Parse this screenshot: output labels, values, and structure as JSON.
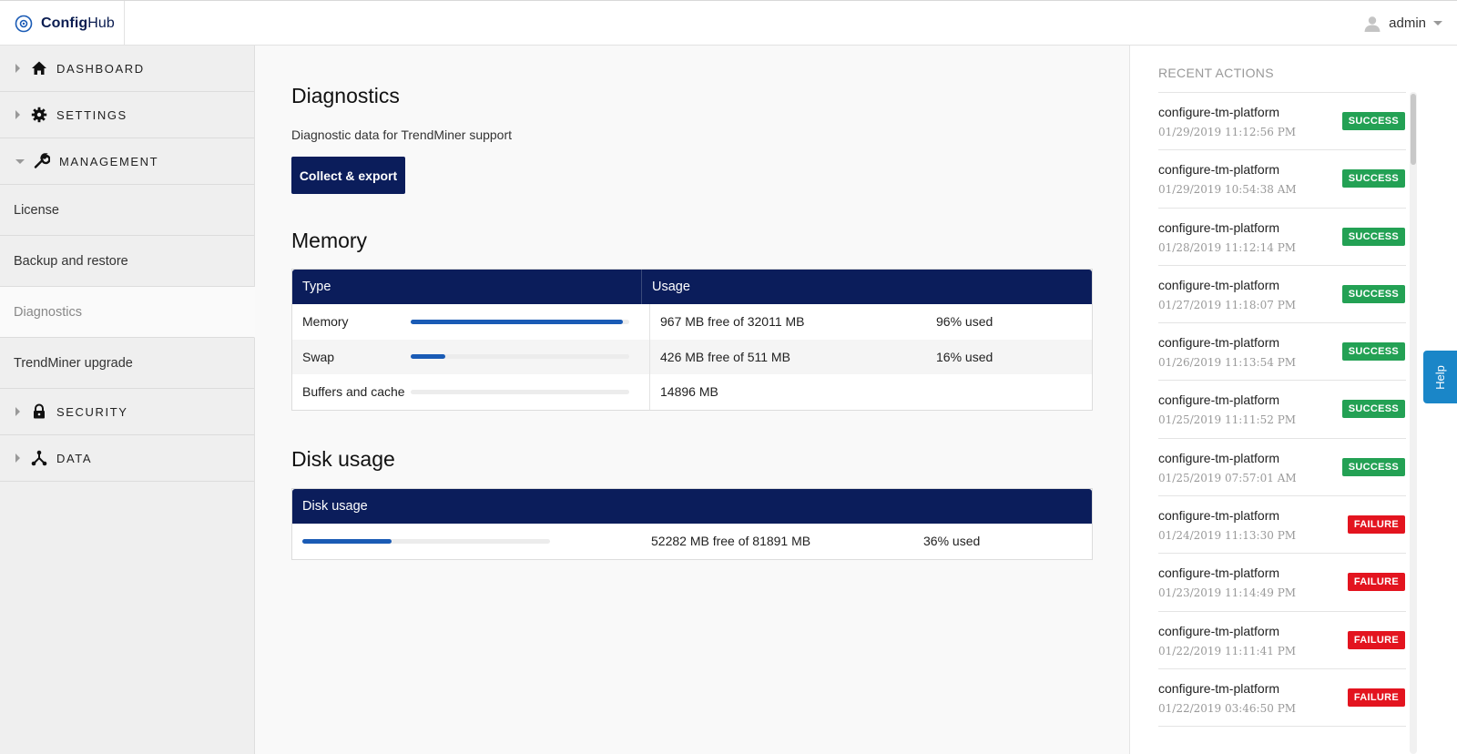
{
  "brand": {
    "name_a": "Config",
    "name_b": "Hub"
  },
  "user": {
    "name": "admin"
  },
  "sidebar": {
    "sections": [
      {
        "label": "DASHBOARD"
      },
      {
        "label": "SETTINGS"
      },
      {
        "label": "MANAGEMENT"
      },
      {
        "label": "SECURITY"
      },
      {
        "label": "DATA"
      }
    ],
    "management_items": [
      {
        "label": "License"
      },
      {
        "label": "Backup and restore"
      },
      {
        "label": "Diagnostics"
      },
      {
        "label": "TrendMiner upgrade"
      }
    ]
  },
  "diagnostics": {
    "title": "Diagnostics",
    "description": "Diagnostic data for TrendMiner support",
    "button": "Collect & export"
  },
  "memory": {
    "title": "Memory",
    "columns": [
      "Type",
      "Usage"
    ],
    "rows": [
      {
        "type": "Memory",
        "used_fraction": 0.97,
        "free": "967 MB free of 32011 MB",
        "pct": "96% used"
      },
      {
        "type": "Swap",
        "used_fraction": 0.16,
        "free": "426 MB free of 511 MB",
        "pct": "16% used"
      },
      {
        "type": "Buffers and cache",
        "used_fraction": 0,
        "free": "14896 MB",
        "pct": ""
      }
    ]
  },
  "disk": {
    "title": "Disk usage",
    "column": "Disk usage",
    "used_fraction": 0.36,
    "free": "52282 MB free of 81891 MB",
    "pct": "36% used"
  },
  "recent": {
    "title": "RECENT ACTIONS",
    "items": [
      {
        "name": "configure-tm-platform",
        "time": "01/29/2019 11:12:56 PM",
        "status": "SUCCESS"
      },
      {
        "name": "configure-tm-platform",
        "time": "01/29/2019 10:54:38 AM",
        "status": "SUCCESS"
      },
      {
        "name": "configure-tm-platform",
        "time": "01/28/2019 11:12:14 PM",
        "status": "SUCCESS"
      },
      {
        "name": "configure-tm-platform",
        "time": "01/27/2019 11:18:07 PM",
        "status": "SUCCESS"
      },
      {
        "name": "configure-tm-platform",
        "time": "01/26/2019 11:13:54 PM",
        "status": "SUCCESS"
      },
      {
        "name": "configure-tm-platform",
        "time": "01/25/2019 11:11:52 PM",
        "status": "SUCCESS"
      },
      {
        "name": "configure-tm-platform",
        "time": "01/25/2019 07:57:01 AM",
        "status": "SUCCESS"
      },
      {
        "name": "configure-tm-platform",
        "time": "01/24/2019 11:13:30 PM",
        "status": "FAILURE"
      },
      {
        "name": "configure-tm-platform",
        "time": "01/23/2019 11:14:49 PM",
        "status": "FAILURE"
      },
      {
        "name": "configure-tm-platform",
        "time": "01/22/2019 11:11:41 PM",
        "status": "FAILURE"
      },
      {
        "name": "configure-tm-platform",
        "time": "01/22/2019 03:46:50 PM",
        "status": "FAILURE"
      }
    ]
  },
  "help": {
    "label": "Help"
  },
  "colors": {
    "navy": "#0b1d5b",
    "bar": "#1a5bb5",
    "success": "#23a154",
    "failure": "#e3141f",
    "help": "#1a86c8"
  }
}
